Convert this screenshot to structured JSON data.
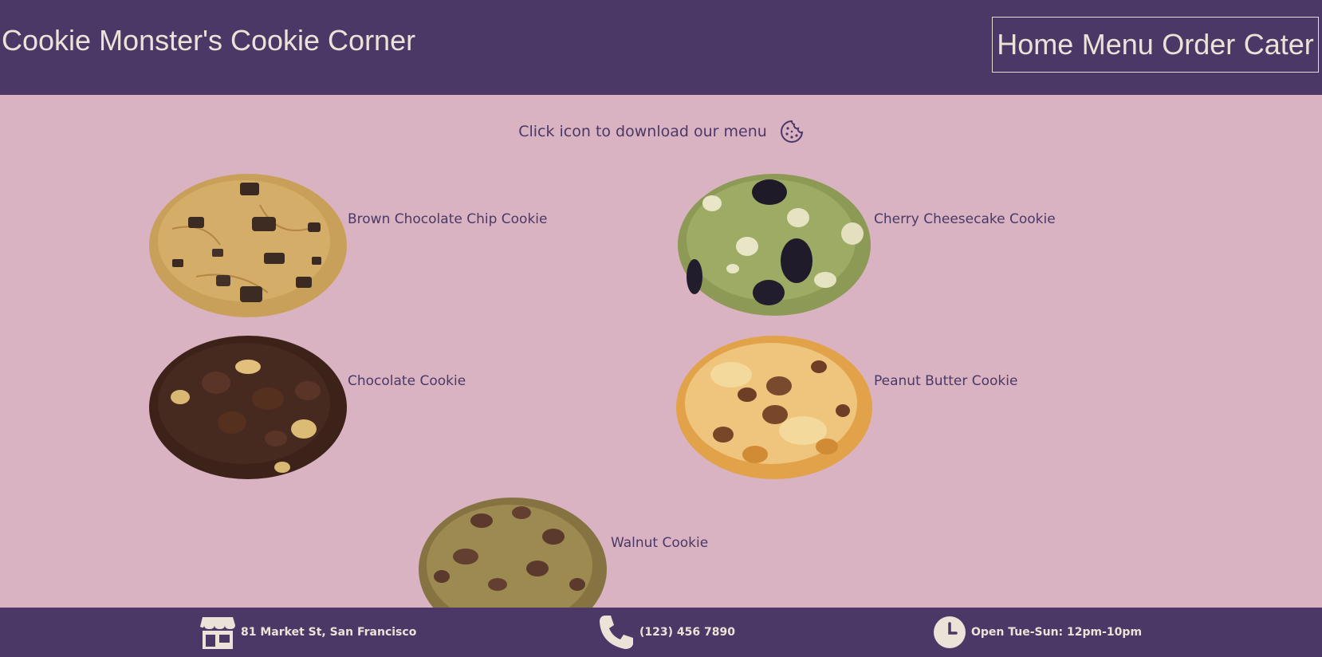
{
  "header": {
    "site_title": "Cookie Monster's Cookie Corner",
    "nav": [
      "Home",
      "Menu",
      "Order",
      "Cater"
    ]
  },
  "main": {
    "download_prompt": "Click icon to download our menu",
    "download_icon": "cookie-icon",
    "cookies": [
      {
        "name": "Brown Chocolate Chip Cookie",
        "image": "chocolate-chip-cookie-photo"
      },
      {
        "name": "Cherry Cheesecake Cookie",
        "image": "cherry-cheesecake-cookie-photo"
      },
      {
        "name": "Chocolate Cookie",
        "image": "chocolate-cookie-photo"
      },
      {
        "name": "Peanut Butter Cookie",
        "image": "peanut-butter-cookie-photo"
      },
      {
        "name": "Walnut Cookie",
        "image": "walnut-cookie-photo"
      }
    ]
  },
  "footer": {
    "address": "81 Market St, San Francisco",
    "address_icon": "storefront-icon",
    "phone": "(123) 456 7890",
    "phone_icon": "phone-icon",
    "hours": "Open Tue-Sun: 12pm-10pm",
    "hours_icon": "clock-icon"
  },
  "colors": {
    "header_bg": "#4b3866",
    "page_bg": "#d9b3c2",
    "header_text": "#ece3d8",
    "body_text": "#4b3866"
  }
}
